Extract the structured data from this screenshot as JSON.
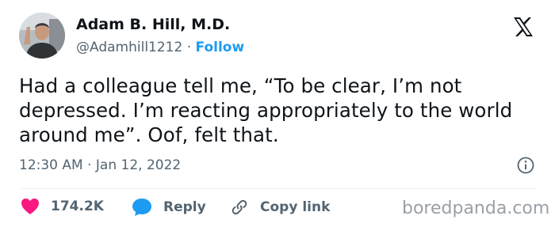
{
  "author": {
    "name": "Adam B. Hill, M.D.",
    "handle": "@Adamhill1212",
    "separator": "·",
    "follow_label": "Follow"
  },
  "tweet": {
    "text": "Had a colleague tell me, “To be clear, I’m not depressed. I’m reacting appropriately to the world around me”. Oof, felt that.",
    "timestamp": "12:30 AM · Jan 12, 2022"
  },
  "actions": {
    "likes_count": "174.2K",
    "reply_label": "Reply",
    "copy_link_label": "Copy link"
  },
  "icons": {
    "brand": "x-logo-icon",
    "info": "info-icon",
    "like": "heart-icon",
    "reply": "speech-bubble-icon",
    "copy": "link-icon"
  },
  "colors": {
    "text": "#0f1419",
    "secondary": "#536471",
    "accent": "#1d9bf0",
    "like": "#f91880"
  },
  "watermark": "boredpanda.com"
}
